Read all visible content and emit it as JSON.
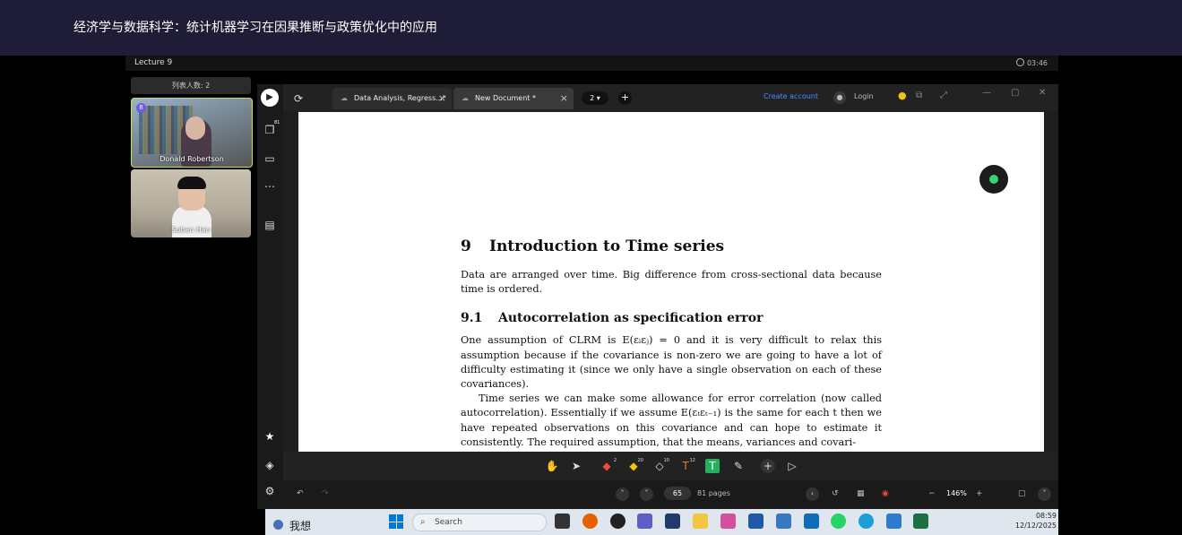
{
  "course_title": "经济学与数据科学：统计机器学习在因果推断与政策优化中的应用",
  "lecture": {
    "name": "Lecture 9",
    "elapsed": "03:46"
  },
  "participants": {
    "count_label": "列表人数: 2",
    "tiles": [
      {
        "name": "Donald Robertson",
        "badge": "8"
      },
      {
        "name": "Suban Han"
      }
    ]
  },
  "app": {
    "tabs": [
      {
        "label": "Data Analysis, Regress...*"
      },
      {
        "label": "New Document *"
      }
    ],
    "tab_count": "2",
    "create_account": "Create account",
    "login": "Login",
    "rail_badges": {
      "docs": "81"
    }
  },
  "document": {
    "section_num": "9",
    "section_title": "Introduction to Time series",
    "intro": "Data are arranged over time. Big difference from cross-sectional data because time is ordered.",
    "subsection_num": "9.1",
    "subsection_title": "Autocorrelation as specification error",
    "para1": "One assumption of CLRM is E(εᵢεⱼ) = 0 and it is very difficult to relax this assumption because if the covariance is non-zero we are going to have a lot of difficulty estimating it (since we only have a single observation on each of these covariances).",
    "para2": "Time series we can make some allowance for error correlation (now called autocorrelation). Essentially if we assume E(εₜεₜ₋₁) is the same for each t then we have repeated observations on this covariance and can hope to estimate it consistently. The required assumption, that the means, variances and covari-"
  },
  "toolbar": {
    "badges": {
      "highlighter": "2",
      "marker": "20",
      "eraser": "10",
      "text": "12"
    }
  },
  "nav": {
    "page": "65",
    "pages_label": "81 pages",
    "zoom": "146%"
  },
  "taskbar": {
    "user_label": "我想",
    "search_label": "Search",
    "time": "08:59",
    "date": "12/12/2025"
  },
  "colors": {
    "topbar": "#1f1c37",
    "accent_blue": "#4a8cff",
    "active_tile_border": "#c8e14a"
  }
}
